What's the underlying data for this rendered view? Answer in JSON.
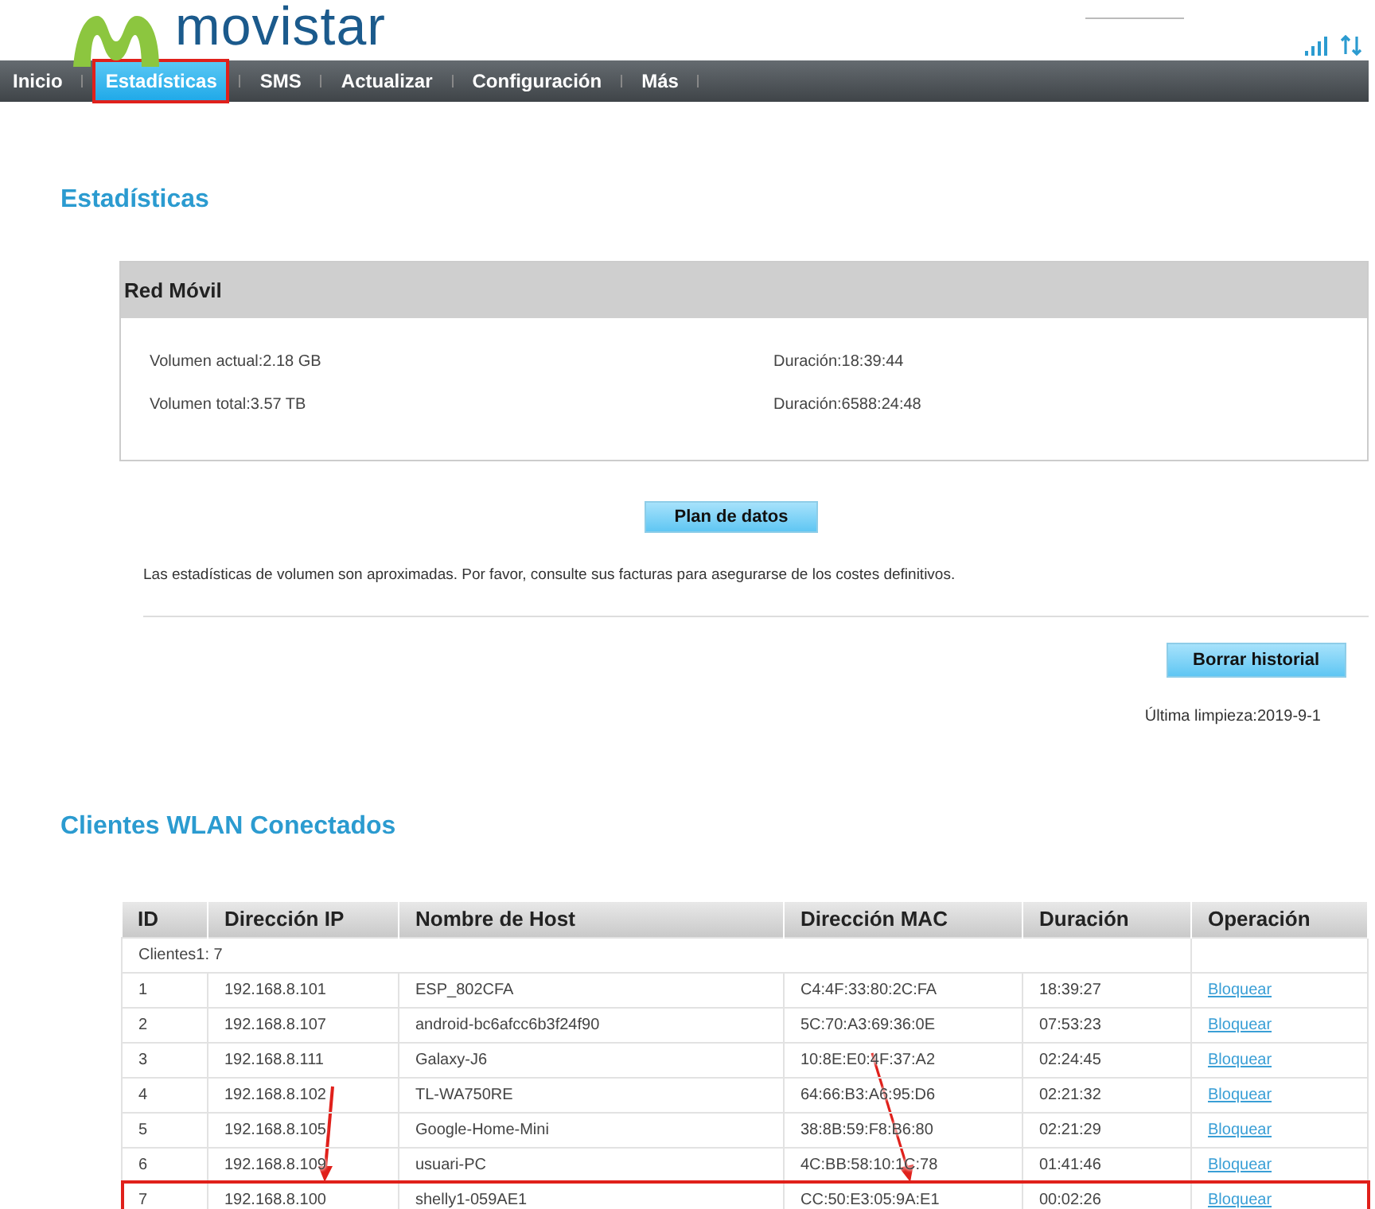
{
  "header": {
    "logo_text": "movistar"
  },
  "nav": [
    {
      "label": "Inicio",
      "selected": false,
      "highlighted": false
    },
    {
      "label": "Estadísticas",
      "selected": true,
      "highlighted": true
    },
    {
      "label": "SMS",
      "selected": false,
      "highlighted": false
    },
    {
      "label": "Actualizar",
      "selected": false,
      "highlighted": false
    },
    {
      "label": "Configuración",
      "selected": false,
      "highlighted": false
    },
    {
      "label": "Más",
      "selected": false,
      "highlighted": false
    }
  ],
  "page_title": "Estadísticas",
  "panel": {
    "title": "Red Móvil",
    "stats": [
      {
        "volume": "Volumen actual:2.18 GB",
        "duration": "Duración:18:39:44"
      },
      {
        "volume": "Volumen total:3.57 TB",
        "duration": "Duración:6588:24:48"
      }
    ]
  },
  "plan_button": "Plan de datos",
  "note": "Las estadísticas de volumen son aproximadas. Por favor, consulte sus facturas para asegurarse de los costes definitivos.",
  "clear_button": "Borrar historial",
  "last_cleared": "Última limpieza:2019-9-1",
  "clients_title": "Clientes WLAN Conectados",
  "table": {
    "columns": [
      "ID",
      "Dirección IP",
      "Nombre de Host",
      "Dirección MAC",
      "Duración",
      "Operación"
    ],
    "summary": "Clientes1: 7",
    "rows": [
      {
        "id": "1",
        "ip": "192.168.8.101",
        "host": "ESP_802CFA",
        "mac": "C4:4F:33:80:2C:FA",
        "duration": "18:39:27",
        "action": "Bloquear",
        "highlighted": false
      },
      {
        "id": "2",
        "ip": "192.168.8.107",
        "host": "android-bc6afcc6b3f24f90",
        "mac": "5C:70:A3:69:36:0E",
        "duration": "07:53:23",
        "action": "Bloquear",
        "highlighted": false
      },
      {
        "id": "3",
        "ip": "192.168.8.111",
        "host": "Galaxy-J6",
        "mac": "10:8E:E0:4F:37:A2",
        "duration": "02:24:45",
        "action": "Bloquear",
        "highlighted": false
      },
      {
        "id": "4",
        "ip": "192.168.8.102",
        "host": "TL-WA750RE",
        "mac": "64:66:B3:A6:95:D6",
        "duration": "02:21:32",
        "action": "Bloquear",
        "highlighted": false
      },
      {
        "id": "5",
        "ip": "192.168.8.105",
        "host": "Google-Home-Mini",
        "mac": "38:8B:59:F8:B6:80",
        "duration": "02:21:29",
        "action": "Bloquear",
        "highlighted": false
      },
      {
        "id": "6",
        "ip": "192.168.8.109",
        "host": "usuari-PC",
        "mac": "4C:BB:58:10:1C:78",
        "duration": "01:41:46",
        "action": "Bloquear",
        "highlighted": false
      },
      {
        "id": "7",
        "ip": "192.168.8.100",
        "host": "shelly1-059AE1",
        "mac": "CC:50:E3:05:9A:E1",
        "duration": "00:02:26",
        "action": "Bloquear",
        "highlighted": true
      }
    ]
  }
}
